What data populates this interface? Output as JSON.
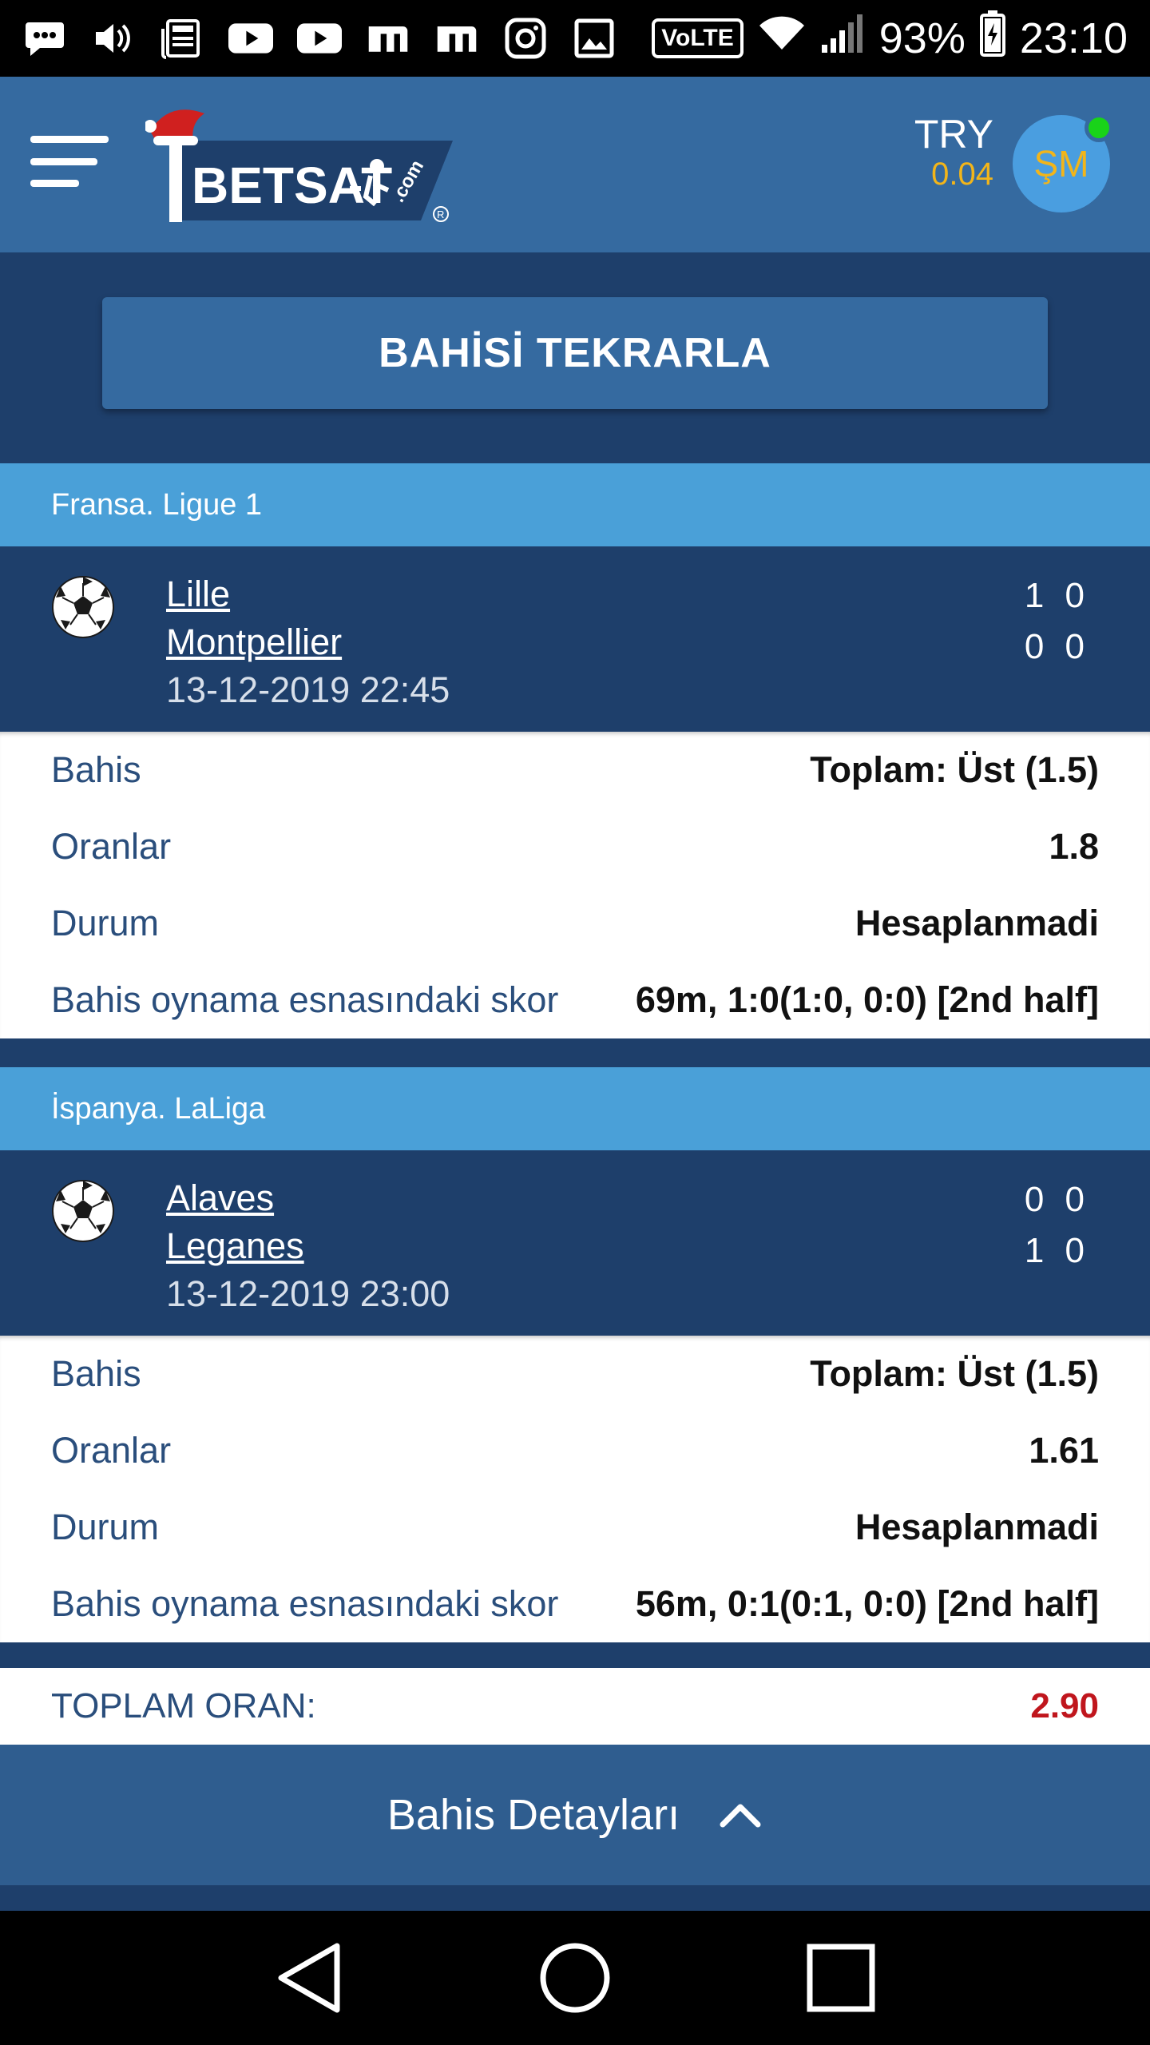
{
  "status_bar": {
    "volte": "VoLTE",
    "battery": "93%",
    "time": "23:10",
    "icons": [
      "chat-icon",
      "volume-icon",
      "news-icon",
      "youtube-icon",
      "youtube-icon",
      "m-icon",
      "m-icon",
      "instagram-icon",
      "gallery-icon",
      "wifi-icon",
      "signal-icon",
      "battery-icon"
    ]
  },
  "header": {
    "logo_text": "BETSAT",
    "logo_suffix": ".com",
    "currency_code": "TRY",
    "balance": "0.04",
    "avatar_initials": "ŞM"
  },
  "repeat_button": "BAHİSİ TEKRARLA",
  "bets": [
    {
      "league": "Fransa. Ligue 1",
      "home": "Lille",
      "away": "Montpellier",
      "datetime": "13-12-2019 22:45",
      "home_score": "1 0",
      "away_score": "0 0",
      "rows": [
        {
          "label": "Bahis",
          "value": "Toplam: Üst (1.5)"
        },
        {
          "label": "Oranlar",
          "value": "1.8"
        },
        {
          "label": "Durum",
          "value": "Hesaplanmadi"
        },
        {
          "label": "Bahis oynama esnasındaki skor",
          "value": "69m, 1:0(1:0, 0:0) [2nd half]"
        }
      ]
    },
    {
      "league": "İspanya. LaLiga",
      "home": "Alaves",
      "away": "Leganes",
      "datetime": "13-12-2019 23:00",
      "home_score": "0 0",
      "away_score": "1 0",
      "rows": [
        {
          "label": "Bahis",
          "value": "Toplam: Üst (1.5)"
        },
        {
          "label": "Oranlar",
          "value": "1.61"
        },
        {
          "label": "Durum",
          "value": "Hesaplanmadi"
        },
        {
          "label": "Bahis oynama esnasındaki skor",
          "value": "56m, 0:1(0:1, 0:0) [2nd half]"
        }
      ]
    }
  ],
  "total": {
    "label": "TOPLAM ORAN:",
    "value": "2.90"
  },
  "details_bar": "Bahis Detayları",
  "colors": {
    "header": "#356aa0",
    "dark": "#1e3f6b",
    "league": "#4aa0d8",
    "total": "#c0161d",
    "balance": "#f2b51a"
  }
}
